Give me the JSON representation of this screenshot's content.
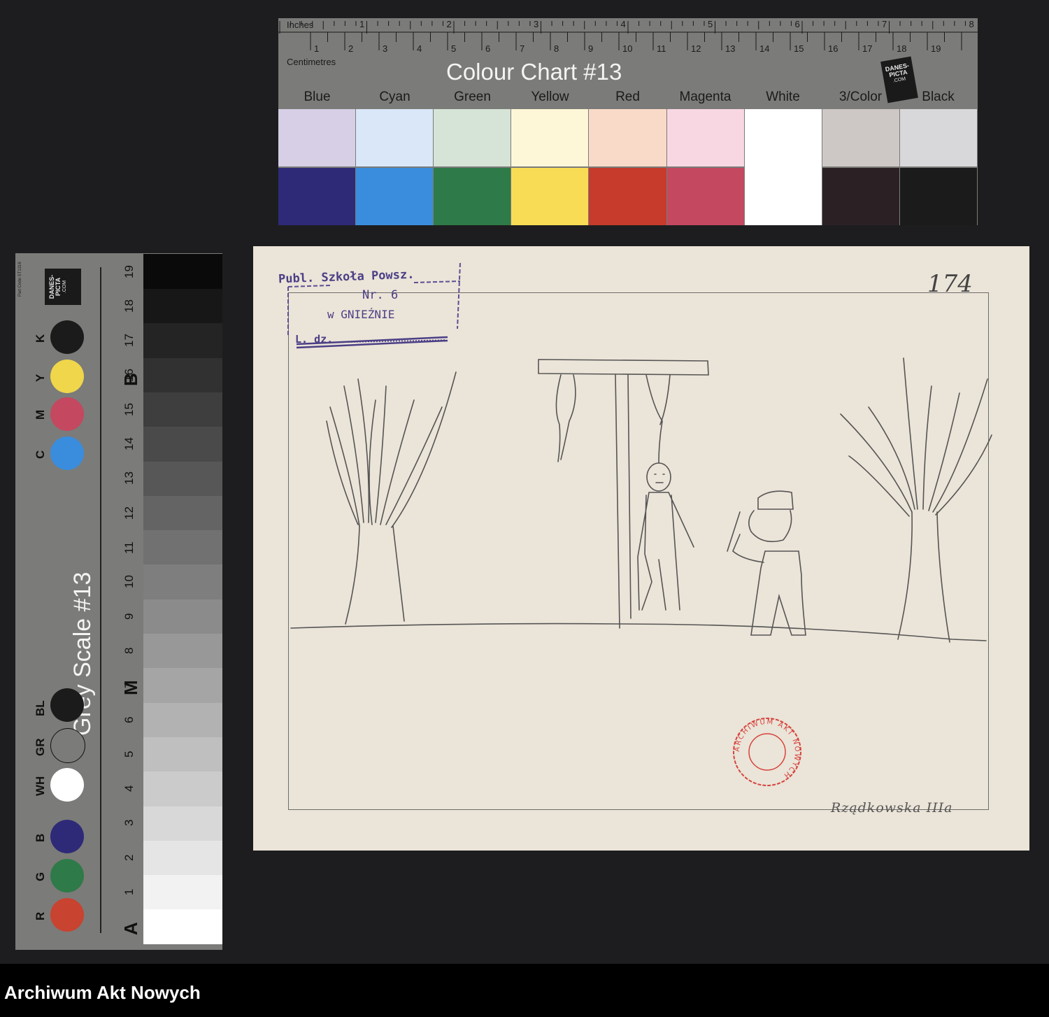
{
  "colour_chart": {
    "title": "Colour Chart #13",
    "inches_label": "Inches",
    "centimetres_label": "Centimetres",
    "inch_numbers": [
      "1",
      "2",
      "3",
      "4",
      "5",
      "6",
      "7",
      "8"
    ],
    "cm_numbers": [
      "1",
      "2",
      "3",
      "4",
      "5",
      "6",
      "7",
      "8",
      "9",
      "10",
      "11",
      "12",
      "13",
      "14",
      "15",
      "16",
      "17",
      "18",
      "19"
    ],
    "colors": [
      {
        "name": "Blue",
        "light": "#d6cfe6",
        "dark": "#2e2a78"
      },
      {
        "name": "Cyan",
        "light": "#d9e7f8",
        "dark": "#3a8ddc"
      },
      {
        "name": "Green",
        "light": "#d5e4d6",
        "dark": "#2e7a48"
      },
      {
        "name": "Yellow",
        "light": "#fdf7d8",
        "dark": "#f8dc55"
      },
      {
        "name": "Red",
        "light": "#f9d9c8",
        "dark": "#c63b2b"
      },
      {
        "name": "Magenta",
        "light": "#f8d7e3",
        "dark": "#c4485f"
      },
      {
        "name": "White",
        "light": "#ffffff",
        "dark": "#ffffff"
      },
      {
        "name": "3/Color",
        "light": "#cdc7c5",
        "dark": "#2b2124"
      },
      {
        "name": "Black",
        "light": "#d8d8da",
        "dark": "#1b1b1c"
      }
    ],
    "logo_text": "DANES-PICTA",
    "logo_sub": ".COM"
  },
  "grey_scale": {
    "title": "Grey Scale #13",
    "code": "Part Code ST1316",
    "logo_text": "DANES-PICTA",
    "logo_sub": ".COM",
    "dots": [
      {
        "label": "R",
        "color": "#c84330"
      },
      {
        "label": "G",
        "color": "#2e7a48"
      },
      {
        "label": "B",
        "color": "#2e2a78"
      },
      {
        "label": "WH",
        "color": "#ffffff"
      },
      {
        "label": "GR",
        "color": "#7b7b79"
      },
      {
        "label": "BL",
        "color": "#1b1b1b"
      },
      {
        "label": "M",
        "color": "#c4485f"
      },
      {
        "label": "C",
        "color": "#3a8ddc"
      },
      {
        "label": "Y",
        "color": "#f0d64a"
      },
      {
        "label": "K",
        "color": "#1b1b1b"
      }
    ],
    "step_numbers": [
      "1",
      "2",
      "3",
      "4",
      "5",
      "6",
      "7",
      "8",
      "9",
      "10",
      "11",
      "12",
      "13",
      "14",
      "15",
      "16",
      "17",
      "18",
      "19"
    ],
    "letters": {
      "a": "A",
      "m": "M",
      "b": "B"
    }
  },
  "document": {
    "stamp": {
      "line1": "Publ. Szkoła Powsz.",
      "line2": "Nr. 6",
      "line3": "w GNIEŹNIE",
      "line4": "L. dz."
    },
    "page_number": "174",
    "seal_text": "ARCHIWUM AKT NOWYCH",
    "signature": "Rządkowska IIIa"
  },
  "footer": {
    "text": "Archiwum Akt Nowych"
  }
}
